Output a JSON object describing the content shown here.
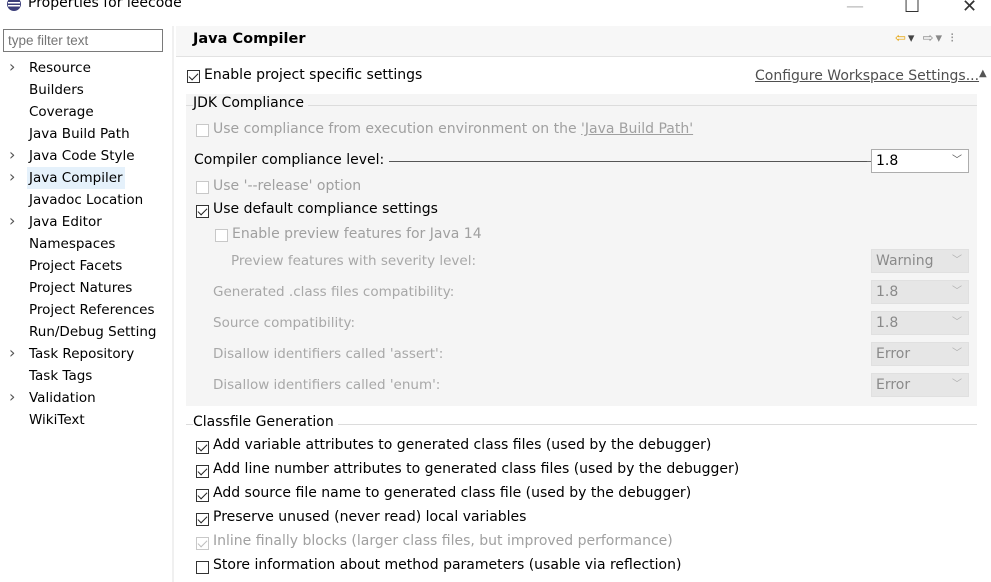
{
  "window": {
    "title": "Properties for leecode",
    "minimize": "—",
    "maximize": "☐",
    "close": "✕"
  },
  "filter": {
    "placeholder": "type filter text"
  },
  "tree": [
    {
      "label": "Resource",
      "expandable": true
    },
    {
      "label": "Builders",
      "expandable": false
    },
    {
      "label": "Coverage",
      "expandable": false
    },
    {
      "label": "Java Build Path",
      "expandable": false
    },
    {
      "label": "Java Code Style",
      "expandable": true
    },
    {
      "label": "Java Compiler",
      "expandable": true,
      "selected": true
    },
    {
      "label": "Javadoc Location",
      "expandable": false
    },
    {
      "label": "Java Editor",
      "expandable": true
    },
    {
      "label": "Namespaces",
      "expandable": false
    },
    {
      "label": "Project Facets",
      "expandable": false
    },
    {
      "label": "Project Natures",
      "expandable": false
    },
    {
      "label": "Project References",
      "expandable": false
    },
    {
      "label": "Run/Debug Setting",
      "expandable": false
    },
    {
      "label": "Task Repository",
      "expandable": true
    },
    {
      "label": "Task Tags",
      "expandable": false
    },
    {
      "label": "Validation",
      "expandable": true
    },
    {
      "label": "WikiText",
      "expandable": false
    }
  ],
  "page": {
    "title": "Java Compiler",
    "enable_specific": "Enable project specific settings",
    "configure_link": "Configure Workspace Settings...",
    "jdk": {
      "group_title": "JDK Compliance",
      "use_compliance_prefix": "Use compliance from execution environment on the ",
      "use_compliance_link": "'Java Build Path'",
      "compliance_label": "Compiler compliance level:",
      "compliance_value": "1.8",
      "release_option": "Use '--release' option",
      "default_compliance": "Use default compliance settings",
      "enable_preview": "Enable preview features for Java 14",
      "preview_severity_label": "Preview features with severity level:",
      "preview_severity_value": "Warning",
      "generated_class_label": "Generated .class files compatibility:",
      "generated_class_value": "1.8",
      "source_compat_label": "Source compatibility:",
      "source_compat_value": "1.8",
      "assert_label": "Disallow identifiers called 'assert':",
      "assert_value": "Error",
      "enum_label": "Disallow identifiers called 'enum':",
      "enum_value": "Error"
    },
    "classfile": {
      "group_title": "Classfile Generation",
      "opt1": "Add variable attributes to generated class files (used by the debugger)",
      "opt2": "Add line number attributes to generated class files (used by the debugger)",
      "opt3": "Add source file name to generated class file (used by the debugger)",
      "opt4": "Preserve unused (never read) local variables",
      "opt5": "Inline finally blocks (larger class files, but improved performance)",
      "opt6": "Store information about method parameters (usable via reflection)"
    }
  },
  "colors": {
    "accent": "#e5a000",
    "selection": "#e5f1fb"
  }
}
